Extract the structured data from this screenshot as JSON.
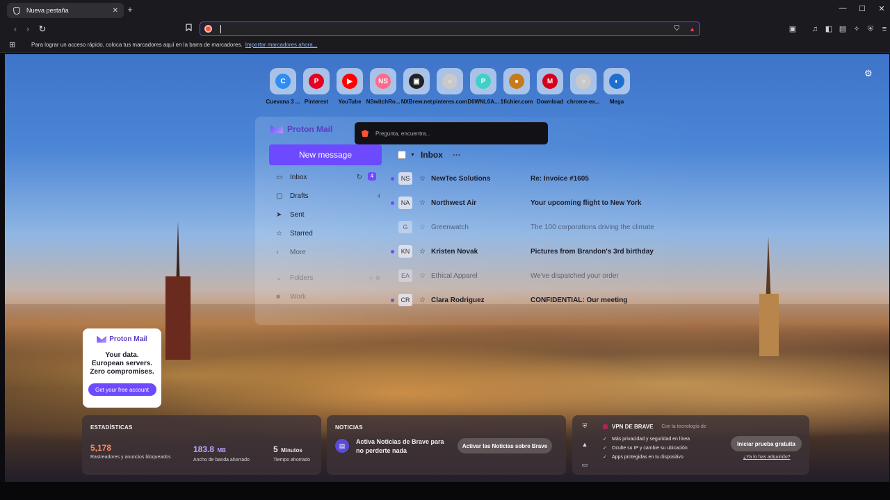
{
  "tab": {
    "title": "Nueva pestaña"
  },
  "window": {
    "new_tab_symbol": "+",
    "minimize": "—",
    "maximize": "☐",
    "close": "✕"
  },
  "toolbar": {
    "back": "‹",
    "forward": "›",
    "reload": "↻",
    "url_value": ""
  },
  "bookmarks_bar": {
    "message": "Para lograr un acceso rápido, coloca tus marcadores aquí en la barra de marcadores.",
    "import_link": "Importar marcadores ahora..."
  },
  "top_sites": [
    {
      "label": "Cuevana 3 ...",
      "color": "#2e8df0",
      "glyph": "C"
    },
    {
      "label": "Pinterest",
      "color": "#e60023",
      "glyph": "P"
    },
    {
      "label": "YouTube",
      "color": "#ff0000",
      "glyph": "▶"
    },
    {
      "label": "NSwitchRo...",
      "color": "#ff6a8a",
      "glyph": "NS"
    },
    {
      "label": "NXBrew.net",
      "color": "#222222",
      "glyph": "▣"
    },
    {
      "label": "pinteres.com",
      "color": "#c9c9c9",
      "glyph": "○"
    },
    {
      "label": "D0WNL0A...",
      "color": "#3fd0c6",
      "glyph": "P"
    },
    {
      "label": "1fichier.com",
      "color": "#c77a1a",
      "glyph": "●"
    },
    {
      "label": "Download",
      "color": "#d4001a",
      "glyph": "M"
    },
    {
      "label": "chrome-ex...",
      "color": "#c9c9c9",
      "glyph": "○"
    },
    {
      "label": "Mega",
      "color": "#1e6fd0",
      "glyph": "◐"
    }
  ],
  "proton_app": {
    "logo": "Proton Mail",
    "new_message": "New message",
    "inbox_title": "Inbox",
    "folders": [
      {
        "label": "Inbox",
        "count": "4",
        "icon": "inbox-icon"
      },
      {
        "label": "Drafts",
        "count": "4",
        "icon": "draft-icon"
      },
      {
        "label": "Sent",
        "count": "",
        "icon": "send-icon"
      },
      {
        "label": "Starred",
        "count": "",
        "icon": "star-icon"
      },
      {
        "label": "More",
        "count": "",
        "icon": "chevron-right-icon"
      },
      {
        "label": "Folders",
        "count": "",
        "icon": "chevron-down-icon"
      },
      {
        "label": "Work",
        "count": "",
        "icon": "folder-icon"
      }
    ],
    "mails": [
      {
        "initials": "NS",
        "sender": "NewTec Solutions",
        "subject": "Re: Invoice #1605",
        "unread": true
      },
      {
        "initials": "NA",
        "sender": "Northwest Air",
        "subject": "Your upcoming flight to New York",
        "unread": true
      },
      {
        "initials": "G",
        "sender": "Greenwatch",
        "subject": "The 100 corporations driving the climate",
        "unread": false
      },
      {
        "initials": "KN",
        "sender": "Kristen Novak",
        "subject": "Pictures from Brandon's 3rd birthday",
        "unread": true
      },
      {
        "initials": "EA",
        "sender": "Ethical Apparel",
        "subject": "We've dispatched your order",
        "unread": false
      },
      {
        "initials": "CR",
        "sender": "Clara Rodriguez",
        "subject": "CONFIDENTIAL: Our meeting",
        "unread": true
      }
    ]
  },
  "ai_prompt": {
    "placeholder": "Pregunta, encuentra..."
  },
  "proton_ad": {
    "logo": "Proton Mail",
    "lines": [
      "Your data.",
      "European servers.",
      "Zero compromises."
    ],
    "cta": "Get your free account"
  },
  "stats": {
    "title": "ESTADÍSTICAS",
    "trackers": {
      "value": "5,178",
      "label": "Rastreadores y anuncios bloqueados",
      "color": "#ff8a65"
    },
    "bandwidth": {
      "value": "183.8",
      "unit": "MB",
      "label": "Ancho de banda ahorrado",
      "color": "#b9a4ff"
    },
    "time": {
      "value": "5",
      "unit": "Minutos",
      "label": "Tiempo ahorrado",
      "color": "#ffffff"
    }
  },
  "news": {
    "title": "NOTICIAS",
    "text": "Activa Noticias de Brave para no perderte nada",
    "button": "Activar las Noticias sobre Brave"
  },
  "vpn": {
    "title": "VPN DE BRAVE",
    "powered_by": "Con la tecnología de",
    "features": [
      "Más privacidad y seguridad en línea",
      "Oculte su IP y cambie su ubicación",
      "Apps protegidas en tu dispositivo"
    ],
    "button": "Iniciar prueba gratuita",
    "link": "¿Ya lo has adquirido?"
  },
  "colors": {
    "accent": "#6d4aff",
    "url_focus": "#6a4cf2",
    "brave_orange": "#ff5133"
  }
}
